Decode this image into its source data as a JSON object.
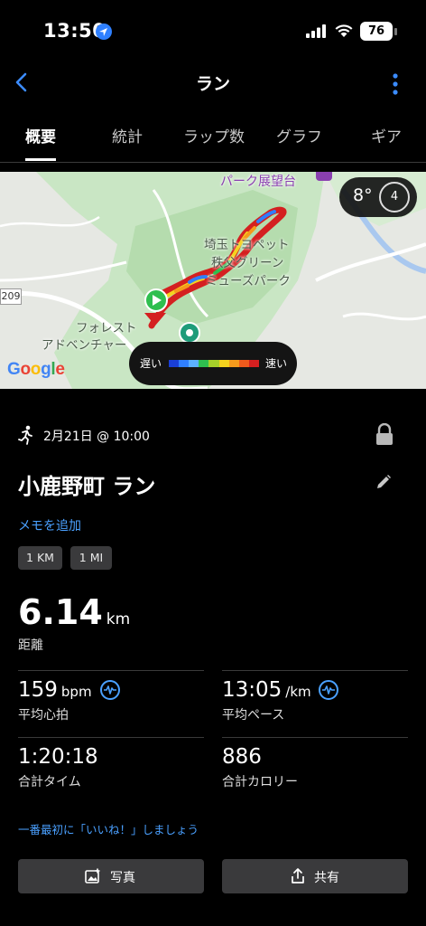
{
  "status_bar": {
    "time": "13:50",
    "battery": "76"
  },
  "nav": {
    "title": "ラン"
  },
  "tabs": [
    {
      "label": "概要",
      "active": true
    },
    {
      "label": "統計",
      "active": false
    },
    {
      "label": "ラップ数",
      "active": false
    },
    {
      "label": "グラフ",
      "active": false
    },
    {
      "label": "ギア",
      "active": false
    }
  ],
  "map": {
    "temperature": "8°",
    "wind": "4",
    "labels": {
      "poi_park": "パーク展望台",
      "dog_park_line1": "埼玉トヨペット",
      "dog_park_line2": "秩父グリーン",
      "dog_park_line3": "ミューズパーク",
      "forest_line1": "フォレスト",
      "forest_line2": "アドベンチャー"
    },
    "road_number": "209",
    "google_logo": "Google",
    "legend_slow": "遅い",
    "legend_fast": "速い",
    "legend_colors": [
      "#1a3fd6",
      "#2f7fff",
      "#5bb0ff",
      "#2fbf4f",
      "#a6d12a",
      "#f4d21e",
      "#f59a1c",
      "#ef5a1c",
      "#d42020"
    ]
  },
  "activity": {
    "date": "2月21日 @ 10:00",
    "title": "小鹿野町 ラン",
    "add_memo": "メモを追加",
    "chips": [
      "1 KM",
      "1 MI"
    ]
  },
  "stats": {
    "distance_value": "6.14",
    "distance_unit": "km",
    "distance_label": "距離",
    "avg_hr_value": "159",
    "avg_hr_unit": "bpm",
    "avg_hr_label": "平均心拍",
    "avg_pace_value": "13:05",
    "avg_pace_unit": "/km",
    "avg_pace_label": "平均ペース",
    "total_time_value": "1:20:18",
    "total_time_label": "合計タイム",
    "calories_value": "886",
    "calories_label": "合計カロリー"
  },
  "like_prompt": "一番最初に「いいね！」しましょう",
  "buttons": {
    "photo": "写真",
    "share": "共有"
  },
  "colors": {
    "accent": "#4aa0ff",
    "background": "#000000",
    "chip": "#3a3a3c"
  }
}
